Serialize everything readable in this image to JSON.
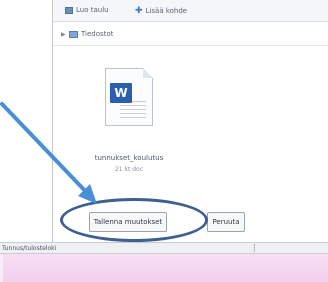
{
  "toolbar": {
    "item1": "Luo taulu",
    "item2": "Lisää kohde"
  },
  "tree": {
    "folder_label": "Tiedostot"
  },
  "file": {
    "icon_letter": "W",
    "name": "tunnukset_koulutus",
    "size": "21 kt doc"
  },
  "buttons": {
    "save": "Tallenna muutokset",
    "cancel": "Peruuta"
  },
  "statusbar": {
    "text": "Tunnus/tulosteloki"
  },
  "colors": {
    "annotation_arrow": "#4a8fd6",
    "annotation_ellipse": "#3f5f8f",
    "word_icon": "#2b5fae",
    "taskbar": "#f3cfee"
  }
}
